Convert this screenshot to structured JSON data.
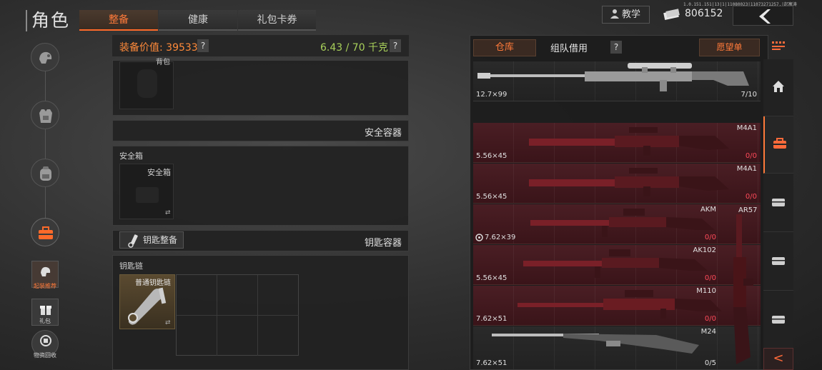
{
  "header": {
    "title": "角色",
    "tabs": [
      {
        "label": "整备",
        "active": true
      },
      {
        "label": "健康",
        "active": false
      },
      {
        "label": "礼包卡券",
        "active": false
      }
    ],
    "version": "1.0.151.151|13|1|11080023|11073271257.|起寓涛",
    "tutorial_label": "教学",
    "money": "806152"
  },
  "left_nav": {
    "icons": [
      "helmet-icon",
      "armor-icon",
      "backpack-icon",
      "toolbox-icon"
    ],
    "small_buttons": [
      {
        "label": "起装推荐",
        "icon": "recommend-icon",
        "active": true
      },
      {
        "label": "礼包",
        "icon": "gift-icon",
        "active": false
      },
      {
        "label": "物资回收",
        "icon": "recycle-icon",
        "active": false
      }
    ]
  },
  "equipment": {
    "value_label": "装备价值: 39533",
    "weight": "6.43 / 70 千克",
    "help": "?",
    "backpack_slot_name": "背包",
    "secure_container_title": "安全容器",
    "secure_box_label": "安全箱",
    "secure_slot_name": "安全箱",
    "key_equip_button": "钥匙整备",
    "key_container_title": "钥匙容器",
    "keychain_label": "钥匙链",
    "keychain_slot_name": "普通钥匙链",
    "swap_glyph": "⇄"
  },
  "storage": {
    "tab_warehouse": "仓库",
    "tab_team": "组队借用",
    "wishlist": "愿望单",
    "items": [
      {
        "name": "",
        "caliber": "12.7×99",
        "count": "7/10",
        "owned": true
      },
      {
        "name": "M4A1",
        "caliber": "5.56×45",
        "count": "0/0",
        "owned": false
      },
      {
        "name": "M4A1",
        "caliber": "5.56×45",
        "count": "0/0",
        "owned": false
      },
      {
        "name": "AKM",
        "caliber": "7.62×39",
        "count": "0/0",
        "owned": false
      },
      {
        "name": "AK102",
        "caliber": "5.56×45",
        "count": "0/0",
        "owned": false
      },
      {
        "name": "M110",
        "caliber": "7.62×51",
        "count": "0/0",
        "owned": false
      },
      {
        "name": "M24",
        "caliber": "7.62×51",
        "count": "0/5",
        "owned": true
      }
    ],
    "side_item_name": "AR57"
  },
  "right_sidebar": {
    "icons": [
      "home-icon",
      "bag-icon",
      "case-icon",
      "case-icon",
      "case-icon"
    ],
    "collapse_glyph": "<"
  },
  "colors": {
    "accent": "#ff7a3a",
    "weight": "#a8d05a",
    "locked_row": "#4a1e24",
    "zero_count": "#ff4a5a"
  }
}
